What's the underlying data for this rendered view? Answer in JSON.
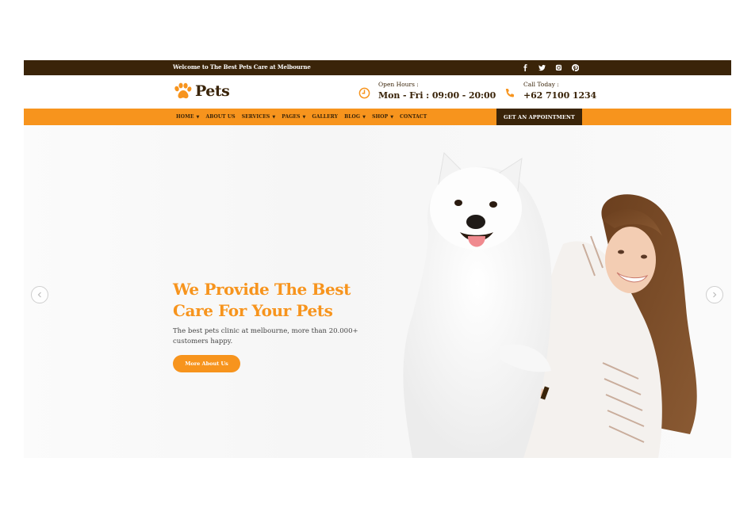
{
  "topbar": {
    "welcome": "Welcome to The Best Pets Care at Melbourne",
    "socials": [
      {
        "icon": "facebook-icon"
      },
      {
        "icon": "twitter-icon"
      },
      {
        "icon": "instagram-icon"
      },
      {
        "icon": "pinterest-icon"
      }
    ]
  },
  "header": {
    "logo_text": "Pets",
    "hours_label": "Open Hours :",
    "hours_value": "Mon - Fri : 09:00 - 20:00",
    "call_label": "Call Today :",
    "call_value": "+62 7100 1234"
  },
  "nav": {
    "items": [
      {
        "label": "HOME",
        "dropdown": true
      },
      {
        "label": "ABOUT US",
        "dropdown": false
      },
      {
        "label": "SERVICES",
        "dropdown": true
      },
      {
        "label": "PAGES",
        "dropdown": true
      },
      {
        "label": "GALLERY",
        "dropdown": false
      },
      {
        "label": "BLOG",
        "dropdown": true
      },
      {
        "label": "SHOP",
        "dropdown": true
      },
      {
        "label": "CONTACT",
        "dropdown": false
      }
    ],
    "appointment": "GET AN APPOINTMENT"
  },
  "hero": {
    "title_line1": "We Provide The Best",
    "title_line2": "Care For Your Pets",
    "description": "The best pets clinic at melbourne, more than 20.000+ customers happy.",
    "cta": "More About Us"
  },
  "colors": {
    "brand_dark": "#3a2409",
    "accent": "#f7941d"
  }
}
